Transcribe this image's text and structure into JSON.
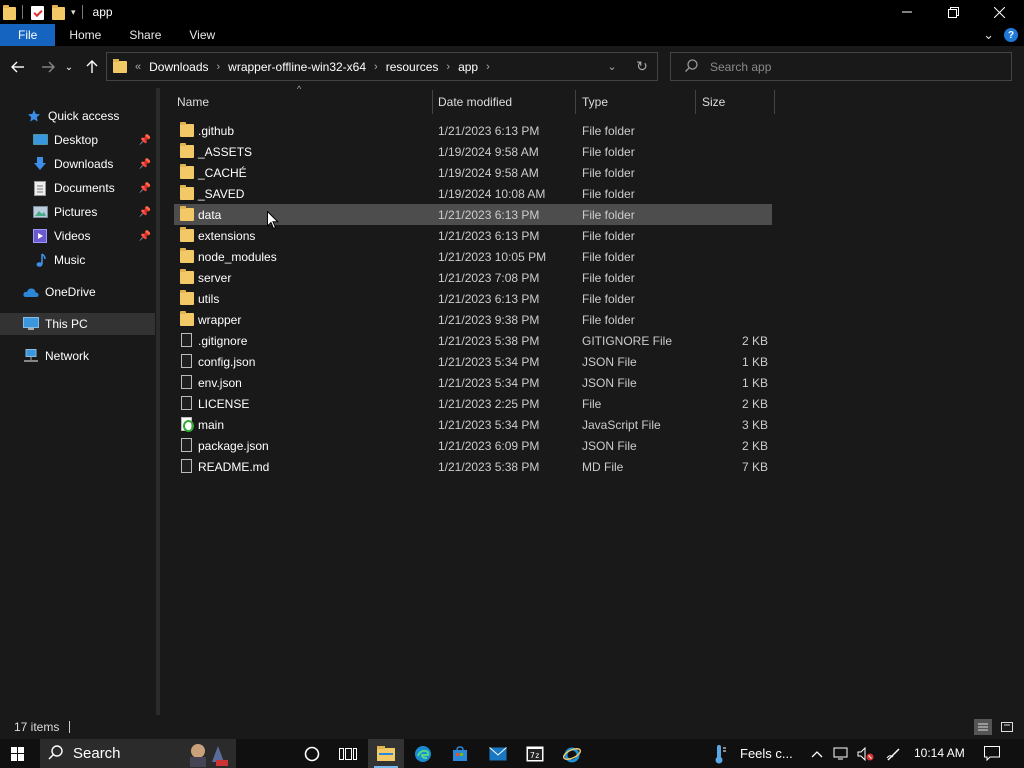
{
  "window": {
    "title": "app",
    "minimize_icon": "minimize-icon",
    "maximize_icon": "maximize-icon",
    "close_icon": "close-icon"
  },
  "ribbon": {
    "tabs": [
      {
        "label": "File"
      },
      {
        "label": "Home"
      },
      {
        "label": "Share"
      },
      {
        "label": "View"
      }
    ]
  },
  "address": {
    "overflow": "«",
    "crumbs": [
      "Downloads",
      "wrapper-offline-win32-x64",
      "resources",
      "app"
    ]
  },
  "search": {
    "placeholder": "Search app",
    "value": ""
  },
  "sidebar": {
    "items": [
      {
        "label": "Quick access",
        "icon": "star-icon",
        "pinned": false
      },
      {
        "label": "Desktop",
        "icon": "desktop-icon",
        "pinned": true
      },
      {
        "label": "Downloads",
        "icon": "download-arrow-icon",
        "pinned": true
      },
      {
        "label": "Documents",
        "icon": "document-icon",
        "pinned": true
      },
      {
        "label": "Pictures",
        "icon": "picture-icon",
        "pinned": true
      },
      {
        "label": "Videos",
        "icon": "video-icon",
        "pinned": true
      },
      {
        "label": "Music",
        "icon": "music-note-icon",
        "pinned": false
      },
      {
        "label": "OneDrive",
        "icon": "cloud-icon",
        "pinned": false
      },
      {
        "label": "This PC",
        "icon": "computer-icon",
        "pinned": false
      },
      {
        "label": "Network",
        "icon": "network-icon",
        "pinned": false
      }
    ]
  },
  "columns": {
    "name": "Name",
    "date": "Date modified",
    "type": "Type",
    "size": "Size"
  },
  "files": [
    {
      "name": ".github",
      "date": "1/21/2023 6:13 PM",
      "type": "File folder",
      "size": "",
      "kind": "folder"
    },
    {
      "name": "_ASSETS",
      "date": "1/19/2024 9:58 AM",
      "type": "File folder",
      "size": "",
      "kind": "folder"
    },
    {
      "name": "_CACHÉ",
      "date": "1/19/2024 9:58 AM",
      "type": "File folder",
      "size": "",
      "kind": "folder"
    },
    {
      "name": "_SAVED",
      "date": "1/19/2024 10:08 AM",
      "type": "File folder",
      "size": "",
      "kind": "folder"
    },
    {
      "name": "data",
      "date": "1/21/2023 6:13 PM",
      "type": "File folder",
      "size": "",
      "kind": "folder"
    },
    {
      "name": "extensions",
      "date": "1/21/2023 6:13 PM",
      "type": "File folder",
      "size": "",
      "kind": "folder"
    },
    {
      "name": "node_modules",
      "date": "1/21/2023 10:05 PM",
      "type": "File folder",
      "size": "",
      "kind": "folder"
    },
    {
      "name": "server",
      "date": "1/21/2023 7:08 PM",
      "type": "File folder",
      "size": "",
      "kind": "folder"
    },
    {
      "name": "utils",
      "date": "1/21/2023 6:13 PM",
      "type": "File folder",
      "size": "",
      "kind": "folder"
    },
    {
      "name": "wrapper",
      "date": "1/21/2023 9:38 PM",
      "type": "File folder",
      "size": "",
      "kind": "folder"
    },
    {
      "name": ".gitignore",
      "date": "1/21/2023 5:38 PM",
      "type": "GITIGNORE File",
      "size": "2 KB",
      "kind": "file"
    },
    {
      "name": "config.json",
      "date": "1/21/2023 5:34 PM",
      "type": "JSON File",
      "size": "1 KB",
      "kind": "file"
    },
    {
      "name": "env.json",
      "date": "1/21/2023 5:34 PM",
      "type": "JSON File",
      "size": "1 KB",
      "kind": "file"
    },
    {
      "name": "LICENSE",
      "date": "1/21/2023 2:25 PM",
      "type": "File",
      "size": "2 KB",
      "kind": "file"
    },
    {
      "name": "main",
      "date": "1/21/2023 5:34 PM",
      "type": "JavaScript File",
      "size": "3 KB",
      "kind": "js"
    },
    {
      "name": "package.json",
      "date": "1/21/2023 6:09 PM",
      "type": "JSON File",
      "size": "2 KB",
      "kind": "file"
    },
    {
      "name": "README.md",
      "date": "1/21/2023 5:38 PM",
      "type": "MD File",
      "size": "7 KB",
      "kind": "file"
    }
  ],
  "status": {
    "item_count": "17 items"
  },
  "taskbar": {
    "search_label": "Search",
    "weather": "Feels c...",
    "clock": "10:14 AM"
  },
  "colors": {
    "accent": "#1565c0",
    "folder": "#f3c968",
    "hover_row": "#4d4d4d",
    "background": "#191919"
  }
}
